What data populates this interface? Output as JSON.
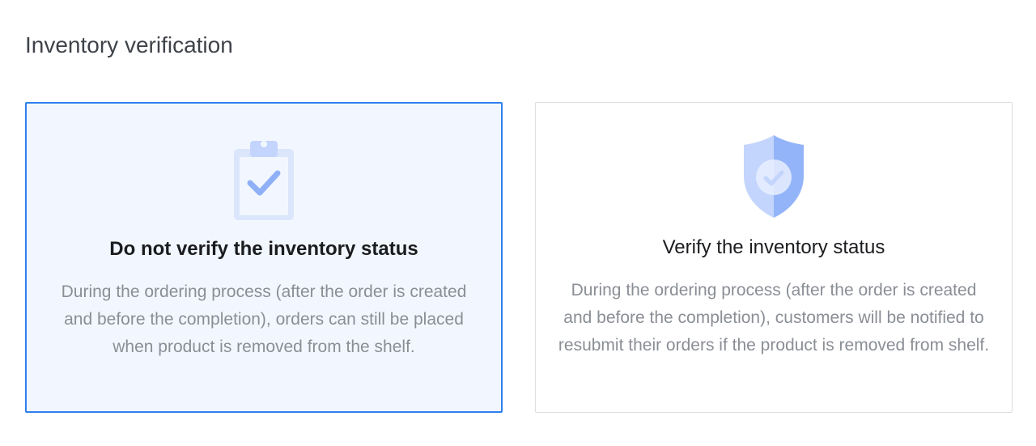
{
  "section": {
    "title": "Inventory verification"
  },
  "options": [
    {
      "title": "Do not verify the inventory status",
      "description": "During the ordering process (after the order is created and before the completion), orders can still be placed when product is removed from the shelf.",
      "icon": "clipboard-check-icon",
      "selected": true
    },
    {
      "title": "Verify the inventory status",
      "description": "During the ordering process (after the order is created and before the completion), customers will be notified to resubmit their orders if the product is removed from shelf.",
      "icon": "shield-check-icon",
      "selected": false
    }
  ],
  "colors": {
    "selected_border": "#2f80ec",
    "selected_background": "#f2f7ff",
    "icon_light": "#dbe6fd",
    "icon_mid": "#c3d5fc",
    "icon_accent": "#8fb0f7"
  }
}
